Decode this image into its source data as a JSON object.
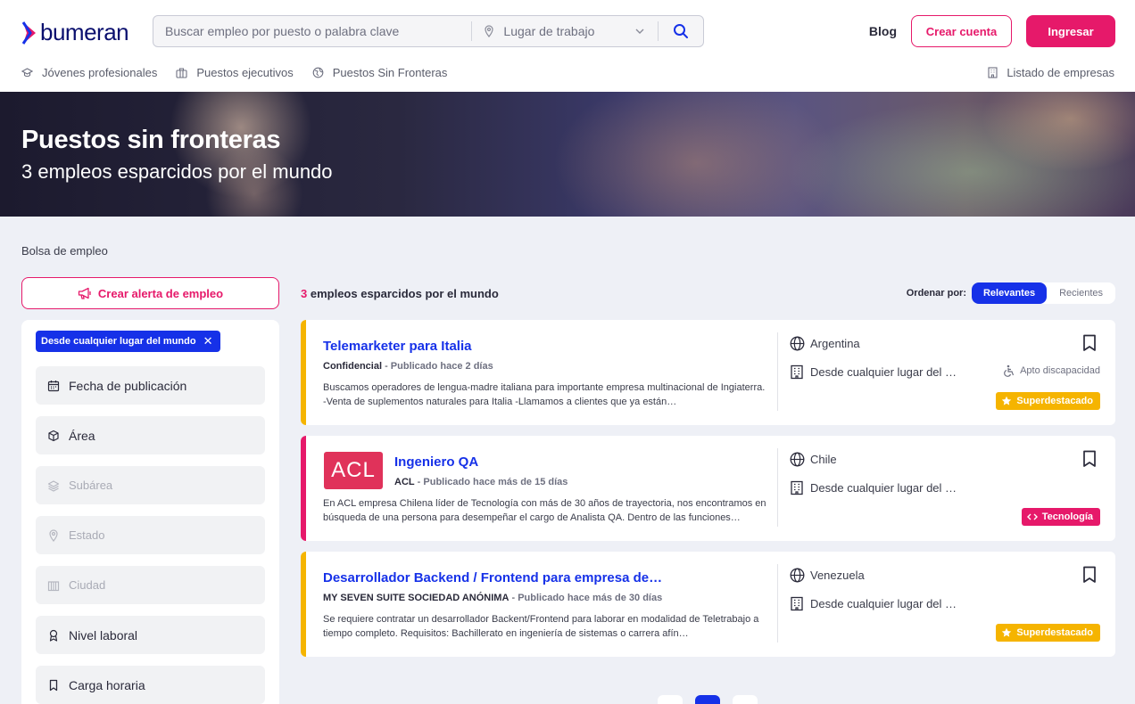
{
  "brand": {
    "name": "bumeran",
    "accent": "#e6196a",
    "primary": "#1631e8",
    "navy": "#0a0f6e"
  },
  "header": {
    "search_placeholder": "Buscar empleo por puesto o palabra clave",
    "location_placeholder": "Lugar de trabajo",
    "blog": "Blog",
    "create_account": "Crear cuenta",
    "login": "Ingresar"
  },
  "subnav": {
    "items": [
      {
        "label": "Jóvenes profesionales",
        "icon": "graduation-cap-icon"
      },
      {
        "label": "Puestos ejecutivos",
        "icon": "briefcase-icon"
      },
      {
        "label": "Puestos Sin Fronteras",
        "icon": "globe-icon"
      }
    ],
    "companies": "Listado de empresas"
  },
  "hero": {
    "title": "Puestos sin fronteras",
    "subtitle": "3 empleos esparcidos por el mundo"
  },
  "breadcrumb": "Bolsa de empleo",
  "sidebar": {
    "alert_button": "Crear alerta de empleo",
    "active_filter": "Desde cualquier lugar del mundo",
    "filters": [
      {
        "label": "Fecha de publicación",
        "icon": "calendar-icon",
        "enabled": true
      },
      {
        "label": "Área",
        "icon": "cube-icon",
        "enabled": true
      },
      {
        "label": "Subárea",
        "icon": "layers-icon",
        "enabled": false
      },
      {
        "label": "Estado",
        "icon": "location-pin-icon",
        "enabled": false
      },
      {
        "label": "Ciudad",
        "icon": "city-icon",
        "enabled": false
      },
      {
        "label": "Nivel laboral",
        "icon": "award-icon",
        "enabled": true
      },
      {
        "label": "Carga horaria",
        "icon": "bookmark-icon",
        "enabled": true
      }
    ]
  },
  "results": {
    "count": "3",
    "count_text": "empleos esparcidos por el mundo",
    "sort_label": "Ordenar por:",
    "sort_options": [
      "Relevantes",
      "Recientes"
    ],
    "sort_selected": "Relevantes"
  },
  "jobs": [
    {
      "title": "Telemarketer para Italia",
      "company": "Confidencial",
      "posted": "Publicado hace 2 días",
      "description": "Buscamos operadores de lengua-madre italiana para importante empresa multinacional de Ingiaterra. -Venta de suplementos naturales para Italia -Llamamos a clientes que ya están…",
      "country": "Argentina",
      "modality": "Desde cualquier lugar del …",
      "accessibility": "Apto discapacidad",
      "badge": "Superdestacado",
      "badge_color": "#f5b400",
      "bar_color": "#f5b400",
      "has_logo": false
    },
    {
      "title": "Ingeniero QA",
      "company": "ACL",
      "posted": "Publicado hace más de 15 días",
      "description": "En ACL empresa Chilena líder de Tecnología con más de 30 años de trayectoria, nos encontramos en búsqueda de una persona para desempeñar el cargo de Analista QA. Dentro de las funciones…",
      "country": "Chile",
      "modality": "Desde cualquier lugar del …",
      "badge": "Tecnología",
      "badge_color": "#e6196a",
      "bar_color": "#e6196a",
      "has_logo": true,
      "logo_text": "ACL",
      "logo_color": "#e0325a"
    },
    {
      "title": "Desarrollador Backend / Frontend para empresa de…",
      "company": "MY SEVEN SUITE SOCIEDAD ANÓNIMA",
      "posted": "Publicado hace más de 30 días",
      "description": "Se requiere contratar un desarrollador Backent/Frontend para laborar en modalidad de Teletrabajo a tiempo completo. Requisitos: Bachillerato en ingeniería de sistemas o carrera afín…",
      "country": "Venezuela",
      "modality": "Desde cualquier lugar del …",
      "badge": "Superdestacado",
      "badge_color": "#f5b400",
      "bar_color": "#f5b400",
      "has_logo": false
    }
  ]
}
